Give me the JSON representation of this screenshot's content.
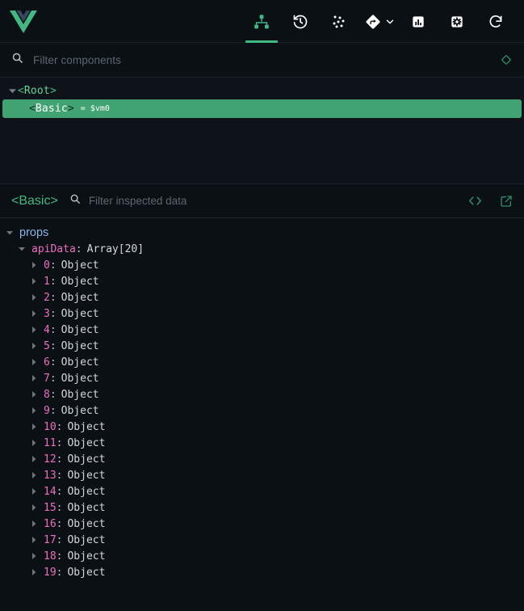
{
  "toolbar": {
    "logo_name": "vue-logo",
    "tabs": [
      {
        "id": "components",
        "icon": "component-tree-icon",
        "label": "Components",
        "active": true
      },
      {
        "id": "timeline",
        "icon": "history-clock-icon",
        "label": "Timeline",
        "active": false
      },
      {
        "id": "pinia",
        "icon": "pinia-dots-icon",
        "label": "Pinia",
        "active": false
      },
      {
        "id": "routes",
        "icon": "router-diamond-icon",
        "label": "Routes",
        "active": false
      }
    ],
    "routes_chevron_icon": "chevron-down-icon",
    "actions": [
      {
        "id": "performance",
        "icon": "bar-chart-icon",
        "label": "Performance"
      },
      {
        "id": "settings",
        "icon": "gear-icon",
        "label": "Settings"
      },
      {
        "id": "refresh",
        "icon": "refresh-icon",
        "label": "Refresh"
      }
    ]
  },
  "filter_bar": {
    "search_icon": "search-icon",
    "placeholder": "Filter components",
    "value": "",
    "right_icon": "diamond-outline-icon"
  },
  "component_tree": {
    "nodes": [
      {
        "name": "Root",
        "open_angle": "<",
        "close_angle": ">",
        "expanded": true,
        "selected": false,
        "vm_tag": ""
      },
      {
        "name": "Basic",
        "open_angle": "<",
        "close_angle": ">",
        "expanded": false,
        "selected": true,
        "vm_tag": "= $vm0"
      }
    ]
  },
  "inspector": {
    "title": "<Basic>",
    "search_icon": "search-icon",
    "placeholder": "Filter inspected data",
    "value": "",
    "actions": [
      {
        "id": "open-in-editor",
        "icon": "code-brackets-icon",
        "label": "<>"
      },
      {
        "id": "open-external",
        "icon": "external-link-icon",
        "label": "Open"
      }
    ]
  },
  "data_tree": {
    "sections": [
      {
        "label": "props",
        "expanded": true,
        "entries": [
          {
            "key": "apiData",
            "colon": ":",
            "value": "Array[20]",
            "expanded": true,
            "children": [
              {
                "index": "0",
                "colon": ":",
                "value": "Object"
              },
              {
                "index": "1",
                "colon": ":",
                "value": "Object"
              },
              {
                "index": "2",
                "colon": ":",
                "value": "Object"
              },
              {
                "index": "3",
                "colon": ":",
                "value": "Object"
              },
              {
                "index": "4",
                "colon": ":",
                "value": "Object"
              },
              {
                "index": "5",
                "colon": ":",
                "value": "Object"
              },
              {
                "index": "6",
                "colon": ":",
                "value": "Object"
              },
              {
                "index": "7",
                "colon": ":",
                "value": "Object"
              },
              {
                "index": "8",
                "colon": ":",
                "value": "Object"
              },
              {
                "index": "9",
                "colon": ":",
                "value": "Object"
              },
              {
                "index": "10",
                "colon": ":",
                "value": "Object"
              },
              {
                "index": "11",
                "colon": ":",
                "value": "Object"
              },
              {
                "index": "12",
                "colon": ":",
                "value": "Object"
              },
              {
                "index": "13",
                "colon": ":",
                "value": "Object"
              },
              {
                "index": "14",
                "colon": ":",
                "value": "Object"
              },
              {
                "index": "15",
                "colon": ":",
                "value": "Object"
              },
              {
                "index": "16",
                "colon": ":",
                "value": "Object"
              },
              {
                "index": "17",
                "colon": ":",
                "value": "Object"
              },
              {
                "index": "18",
                "colon": ":",
                "value": "Object"
              },
              {
                "index": "19",
                "colon": ":",
                "value": "Object"
              }
            ]
          }
        ]
      }
    ]
  },
  "colors": {
    "background": "#0b1015",
    "panel": "#0d1319",
    "divider": "#1a222b",
    "vue_green": "#42b883",
    "vue_dark": "#35495e",
    "selection_green": "#42a372",
    "key_pink": "#f06ec0",
    "section_blue": "#8ab4e8",
    "value_gray": "#d3d8de",
    "placeholder": "#5c666f"
  }
}
